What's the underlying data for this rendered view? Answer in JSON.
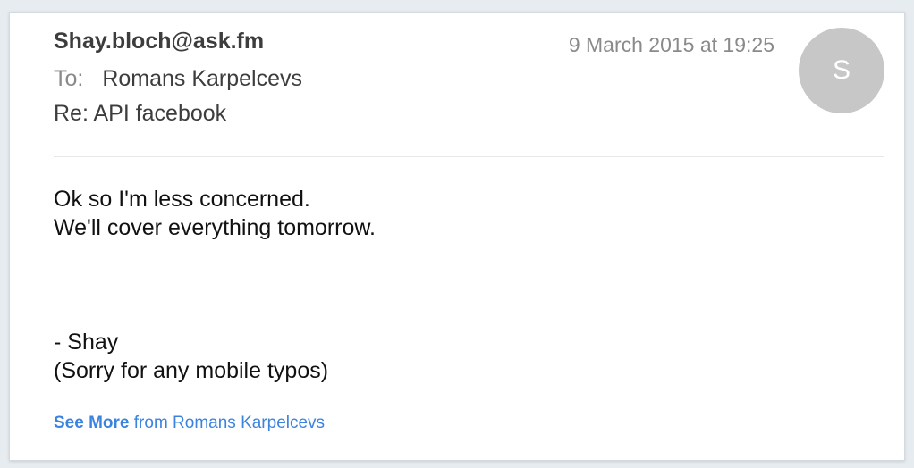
{
  "email": {
    "sender": "Shay.bloch@ask.fm",
    "to_label": "To:",
    "recipient": "Romans Karpelcevs",
    "subject": "Re: API facebook",
    "date": "9 March 2015 at 19:25",
    "avatar_initial": "S",
    "body_lines": [
      "Ok so I'm less concerned.",
      "We'll cover everything tomorrow."
    ],
    "signature_lines": [
      "- Shay",
      "(Sorry for any mobile typos)"
    ]
  },
  "footer": {
    "see_more_bold": "See More",
    "see_more_rest": "from Romans Karpelcevs"
  },
  "colors": {
    "link": "#3c83e0",
    "avatar": "#c7c7c7",
    "muted_text": "#8a8a8a"
  }
}
